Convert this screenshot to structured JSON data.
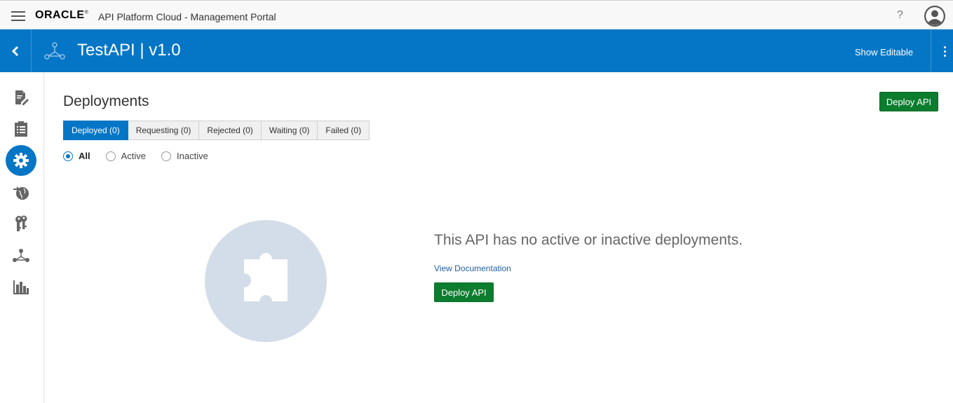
{
  "topbar": {
    "brand": "ORACLE",
    "brand_mark": "®",
    "portal_title": "API Platform Cloud - Management Portal",
    "help_label": "?"
  },
  "header": {
    "api_title": "TestAPI | v1.0",
    "show_editable": "Show Editable"
  },
  "sidebar": {
    "items": [
      {
        "icon": "document-edit-icon",
        "active": false
      },
      {
        "icon": "checklist-icon",
        "active": false
      },
      {
        "icon": "gear-icon",
        "active": true
      },
      {
        "icon": "globe-arrow-icon",
        "active": false
      },
      {
        "icon": "keys-icon",
        "active": false
      },
      {
        "icon": "api-nodes-icon",
        "active": false
      },
      {
        "icon": "bar-chart-icon",
        "active": false
      }
    ]
  },
  "main": {
    "title": "Deployments",
    "deploy_button": "Deploy API",
    "tabs": [
      {
        "label": "Deployed (0)",
        "selected": true
      },
      {
        "label": "Requesting (0)",
        "selected": false
      },
      {
        "label": "Rejected (0)",
        "selected": false
      },
      {
        "label": "Waiting (0)",
        "selected": false
      },
      {
        "label": "Failed (0)",
        "selected": false
      }
    ],
    "filters": [
      {
        "label": "All",
        "checked": true
      },
      {
        "label": "Active",
        "checked": false
      },
      {
        "label": "Inactive",
        "checked": false
      }
    ],
    "empty": {
      "message": "This API has no active or inactive deployments.",
      "link": "View Documentation",
      "button": "Deploy API"
    }
  },
  "colors": {
    "header_blue": "#0576c6",
    "deploy_green": "#0c7d2e",
    "illustration": "#d3dde9"
  }
}
